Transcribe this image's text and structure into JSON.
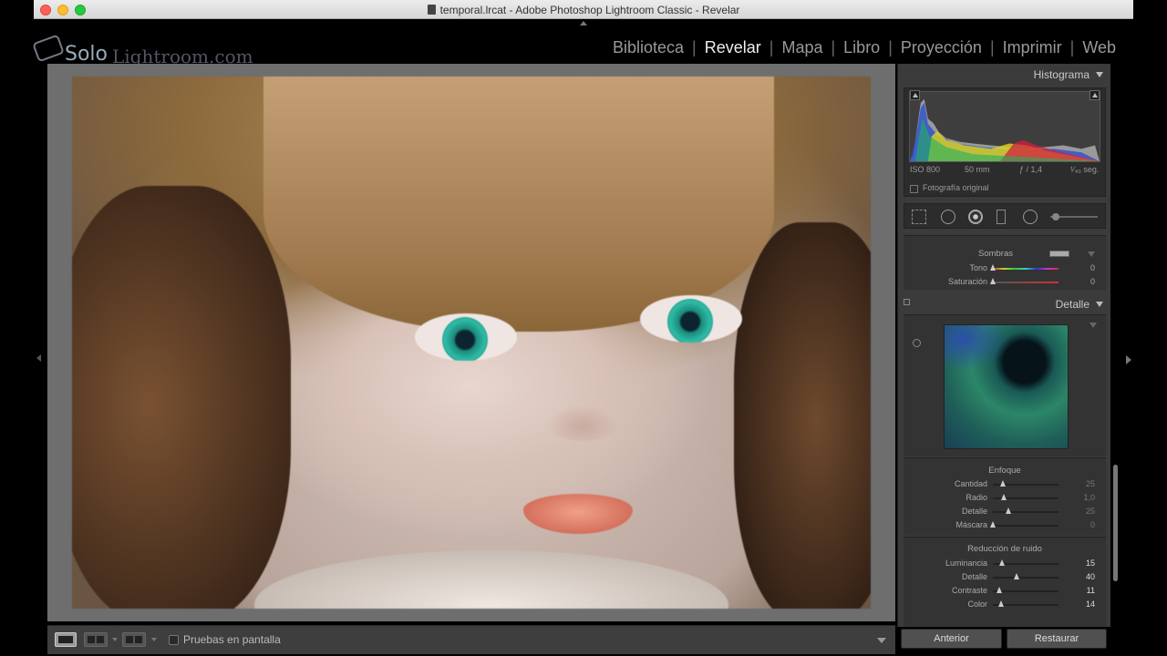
{
  "window": {
    "title": "temporal.lrcat - Adobe Photoshop Lightroom Classic - Revelar"
  },
  "logo": {
    "solo": "Solo",
    "rest": "Lightroom.com"
  },
  "modules": {
    "items": [
      "Biblioteca",
      "Revelar",
      "Mapa",
      "Libro",
      "Proyección",
      "Imprimir",
      "Web"
    ],
    "active": "Revelar"
  },
  "toolbar": {
    "soft_proof_label": "Pruebas en pantalla"
  },
  "histogram": {
    "title": "Histograma",
    "iso": "ISO 800",
    "focal": "50 mm",
    "aperture": "ƒ / 1,4",
    "shutter": "¹⁄₄₀ seg.",
    "original_label": "Fotografía original"
  },
  "split_toning": {
    "sombras_label": "Sombras",
    "tono_label": "Tono",
    "tono_value": "0",
    "saturacion_label": "Saturación",
    "saturacion_value": "0"
  },
  "detail": {
    "title": "Detalle",
    "sharpening": {
      "title": "Enfoque",
      "sliders": [
        {
          "label": "Cantidad",
          "value": "25",
          "pos": 0.16
        },
        {
          "label": "Radio",
          "value": "1,0",
          "pos": 0.18
        },
        {
          "label": "Detalle",
          "value": "25",
          "pos": 0.25
        },
        {
          "label": "Máscara",
          "value": "0",
          "pos": 0.0
        }
      ]
    },
    "noise": {
      "title": "Reducción de ruido",
      "sliders": [
        {
          "label": "Luminancia",
          "value": "15",
          "pos": 0.15
        },
        {
          "label": "Detalle",
          "value": "40",
          "pos": 0.4
        },
        {
          "label": "Contraste",
          "value": "11",
          "pos": 0.11
        },
        {
          "label": "Color",
          "value": "14",
          "pos": 0.14
        }
      ]
    }
  },
  "buttons": {
    "previous": "Anterior",
    "reset": "Restaurar"
  }
}
